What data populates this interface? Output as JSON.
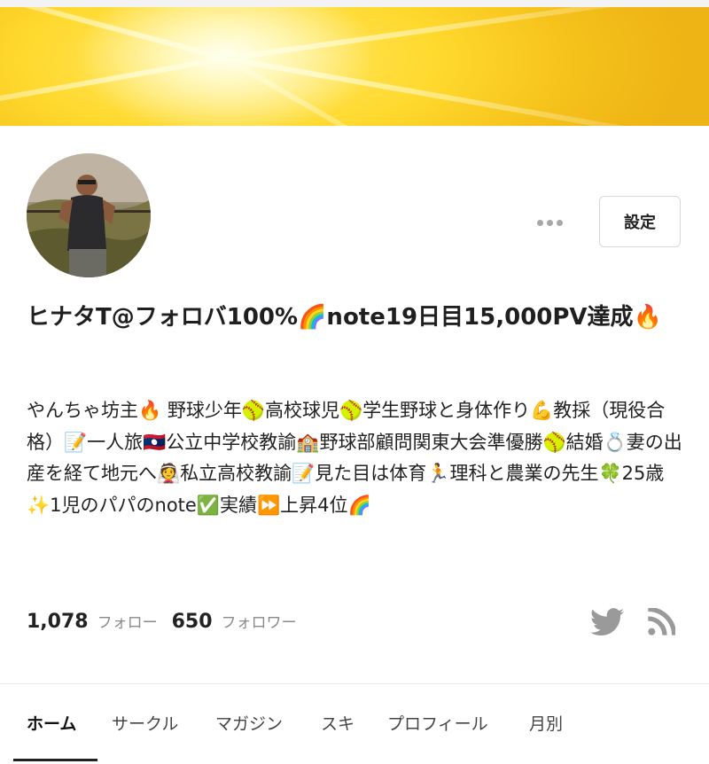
{
  "profile": {
    "display_name": "ヒナタT@フォロバ100%🌈note19日目15,000PV達成🔥",
    "bio": "やんちゃ坊主🔥 野球少年🥎高校球児🥎学生野球と身体作り💪教採（現役合格）📝一人旅🇱🇦公立中学校教諭🏫野球部顧問関東大会準優勝🥎結婚💍妻の出産を経て地元へ👰私立高校教諭📝見た目は体育🏃理科と農業の先生🍀25歳✨1児のパパのnote✅実績⏩上昇4位🌈"
  },
  "actions": {
    "more_label": "•••",
    "settings_label": "設定"
  },
  "stats": {
    "following_count": "1,078",
    "following_label": "フォロー",
    "followers_count": "650",
    "followers_label": "フォロワー"
  },
  "social": {
    "icons": [
      "twitter-icon",
      "rss-icon"
    ],
    "colors": {
      "icon": "#9a9a9a"
    }
  },
  "tabs": [
    {
      "label": "ホーム",
      "active": true
    },
    {
      "label": "サークル"
    },
    {
      "label": "マガジン"
    },
    {
      "label": "スキ"
    },
    {
      "label": "プロフィール"
    },
    {
      "label": "月別"
    }
  ],
  "colors": {
    "banner": "#f5c11b",
    "text": "#222222",
    "muted": "#8a8a8a"
  }
}
